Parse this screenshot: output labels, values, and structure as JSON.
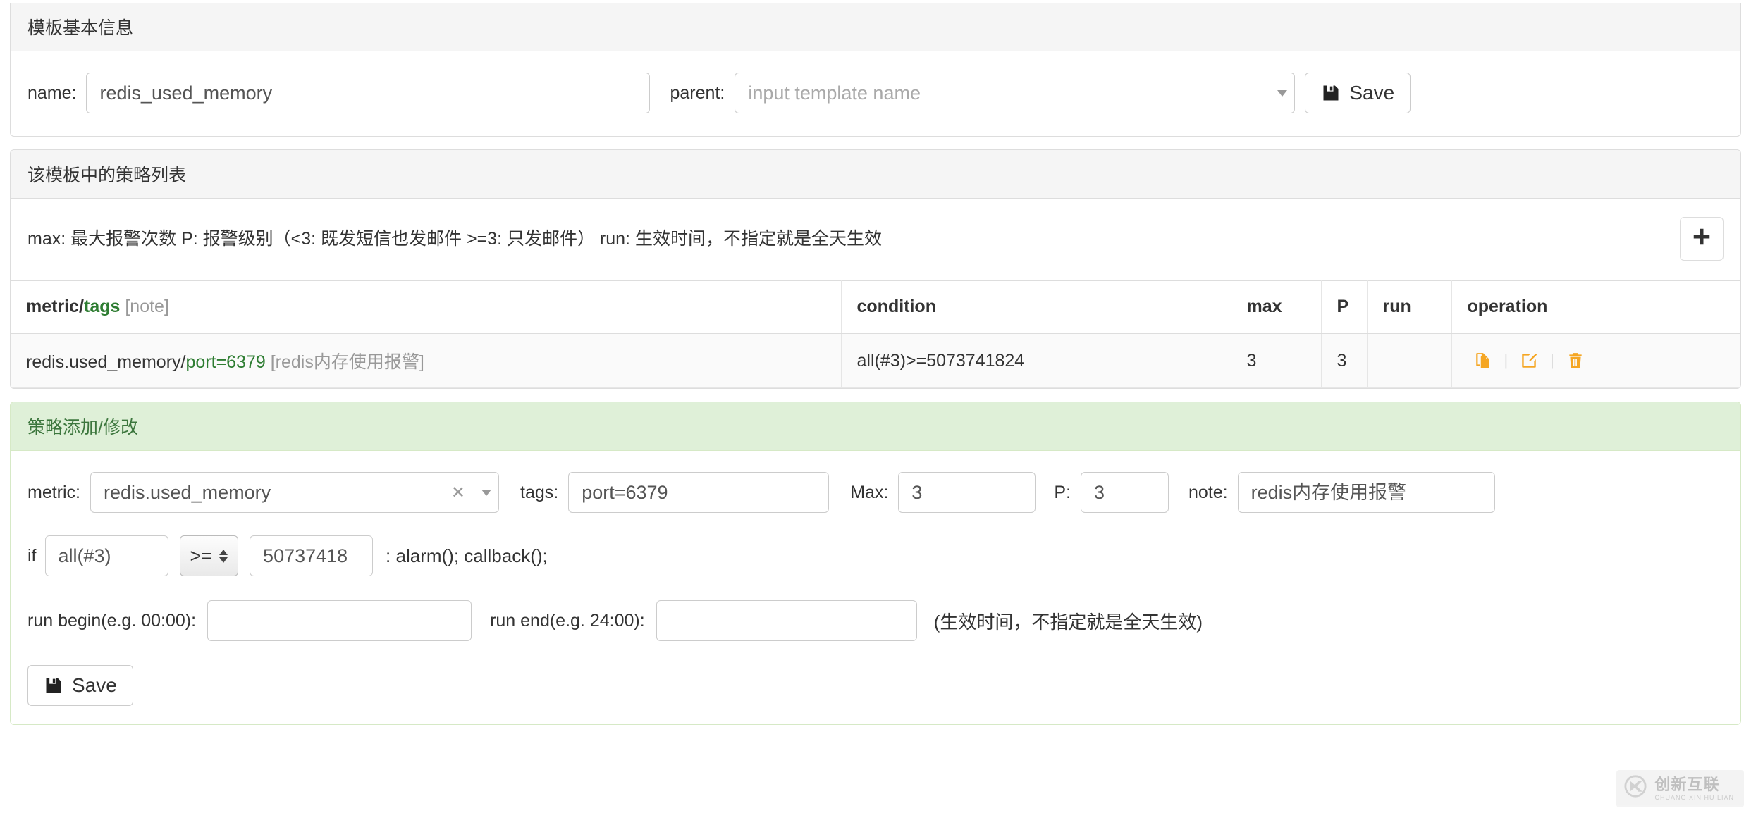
{
  "template_section": {
    "header": "模板基本信息",
    "name_label": "name:",
    "name_value": "redis_used_memory",
    "parent_label": "parent:",
    "parent_placeholder": "input template name",
    "parent_value": "",
    "save_label": "Save",
    "save_icon": "floppy-disk-icon",
    "dropdown_icon": "chevron-down-icon"
  },
  "strategy_section": {
    "header": "该模板中的策略列表",
    "legend": "max: 最大报警次数 P: 报警级别（<3: 既发短信也发邮件 >=3: 只发邮件） run: 生效时间，不指定就是全天生效",
    "add_icon": "plus-icon",
    "columns": {
      "metric": "metric",
      "slash": "/",
      "tags": "tags",
      "note": "[note]",
      "condition": "condition",
      "max": "max",
      "p": "P",
      "run": "run",
      "operation": "operation"
    },
    "rows": [
      {
        "metric": "redis.used_memory/",
        "tags": "port=6379",
        "note": " [redis内存使用报警]",
        "condition": "all(#3)>=5073741824",
        "max": "3",
        "p": "3",
        "run": "",
        "operations": [
          "clone-icon",
          "edit-icon",
          "delete-icon"
        ]
      }
    ],
    "accent_color": "#f5a623",
    "tag_color": "#2e7d32"
  },
  "edit_section": {
    "header": "策略添加/修改",
    "metric_label": "metric:",
    "metric_value": "redis.used_memory",
    "metric_clear_icon": "close-icon",
    "metric_dropdown_icon": "chevron-down-icon",
    "tags_label": "tags:",
    "tags_value": "port=6379",
    "max_label": "Max:",
    "max_value": "3",
    "p_label": "P:",
    "p_value": "3",
    "note_label": "note:",
    "note_value": "redis内存使用报警",
    "if_label": "if",
    "func_value": "all(#3)",
    "operator_value": ">=",
    "operator_icon": "spinner-arrows-icon",
    "threshold_value": "50737418",
    "action_text": ": alarm(); callback();",
    "run_begin_label": "run begin(e.g. 00:00):",
    "run_begin_value": "",
    "run_end_label": "run end(e.g. 24:00):",
    "run_end_value": "",
    "run_hint": "(生效时间，不指定就是全天生效)",
    "save_label": "Save",
    "save_icon": "floppy-disk-icon",
    "header_color": "#3c763d"
  },
  "watermark": {
    "logo_icon": "cx-logo-icon",
    "cn": "创新互联",
    "en": "CHUANG XIN HU LIAN"
  }
}
